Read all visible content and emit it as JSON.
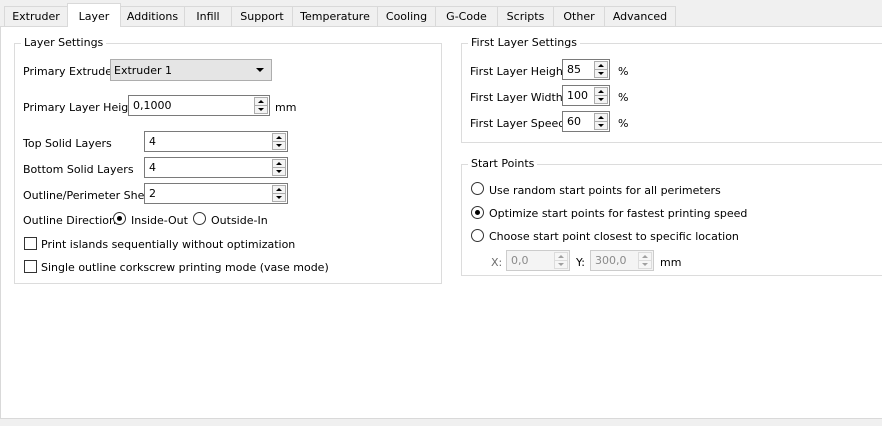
{
  "tabs": [
    {
      "label": "Extruder"
    },
    {
      "label": "Layer"
    },
    {
      "label": "Additions"
    },
    {
      "label": "Infill"
    },
    {
      "label": "Support"
    },
    {
      "label": "Temperature"
    },
    {
      "label": "Cooling"
    },
    {
      "label": "G-Code"
    },
    {
      "label": "Scripts"
    },
    {
      "label": "Other"
    },
    {
      "label": "Advanced"
    }
  ],
  "active_tab": "Layer",
  "layer_settings": {
    "title": "Layer Settings",
    "primary_extruder": {
      "label": "Primary Extruder",
      "value": "Extruder 1"
    },
    "primary_layer_height": {
      "label": "Primary Layer Height",
      "value": "0,1000",
      "unit": "mm"
    },
    "top_solid_layers": {
      "label": "Top Solid Layers",
      "value": "4"
    },
    "bottom_solid_layers": {
      "label": "Bottom Solid Layers",
      "value": "4"
    },
    "outline_shells": {
      "label": "Outline/Perimeter Shells",
      "value": "2"
    },
    "outline_direction": {
      "label": "Outline Direction:",
      "options": [
        "Inside-Out",
        "Outside-In"
      ],
      "selected": "Inside-Out"
    },
    "print_islands": {
      "label": "Print islands sequentially without optimization",
      "checked": false
    },
    "vase_mode": {
      "label": "Single outline corkscrew printing mode (vase mode)",
      "checked": false
    }
  },
  "first_layer_settings": {
    "title": "First Layer Settings",
    "height": {
      "label": "First Layer Height",
      "value": "85",
      "unit": "%"
    },
    "width": {
      "label": "First Layer Width",
      "value": "100",
      "unit": "%"
    },
    "speed": {
      "label": "First Layer Speed",
      "value": "60",
      "unit": "%"
    }
  },
  "start_points": {
    "title": "Start Points",
    "options": [
      "Use random start points for all perimeters",
      "Optimize start points for fastest printing speed",
      "Choose start point closest to specific location"
    ],
    "selected": "Optimize start points for fastest printing speed",
    "x": {
      "label": "X:",
      "value": "0,0"
    },
    "y": {
      "label": "Y:",
      "value": "300,0"
    },
    "unit": "mm"
  }
}
